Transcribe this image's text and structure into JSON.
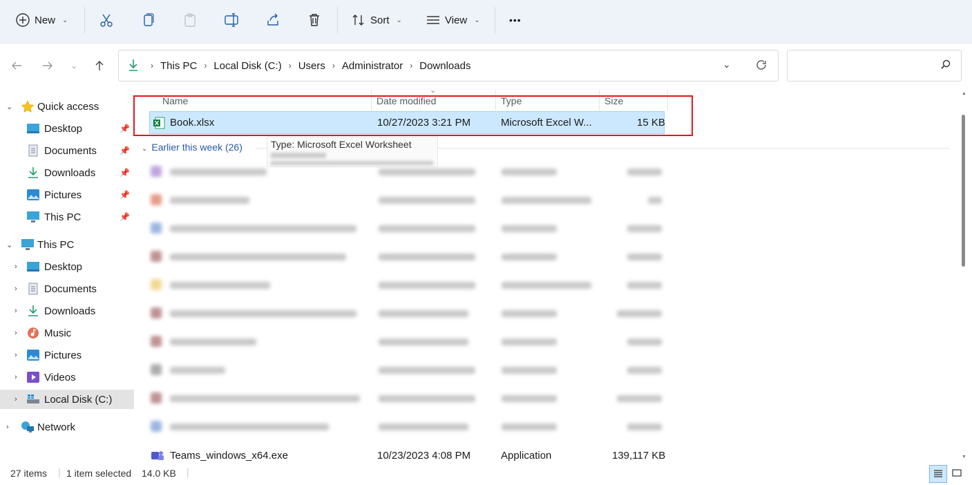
{
  "toolbar": {
    "new_label": "New",
    "sort_label": "Sort",
    "view_label": "View",
    "more_label": "•••"
  },
  "address": {
    "crumbs": [
      "This PC",
      "Local Disk (C:)",
      "Users",
      "Administrator",
      "Downloads"
    ]
  },
  "search": {
    "placeholder": ""
  },
  "sidebar": {
    "quick_access": "Quick access",
    "qa_items": [
      "Desktop",
      "Documents",
      "Downloads",
      "Pictures",
      "This PC"
    ],
    "this_pc": "This PC",
    "pc_items": [
      "Desktop",
      "Documents",
      "Downloads",
      "Music",
      "Pictures",
      "Videos",
      "Local Disk (C:)"
    ],
    "network": "Network"
  },
  "columns": {
    "name": "Name",
    "date": "Date modified",
    "type": "Type",
    "size": "Size"
  },
  "selected_file": {
    "name": "Book.xlsx",
    "date": "10/27/2023 3:21 PM",
    "type": "Microsoft Excel W...",
    "size": "15 KB"
  },
  "tooltip": {
    "type_line": "Type: Microsoft Excel Worksheet"
  },
  "group": {
    "label": "Earlier this week (26)"
  },
  "last_file": {
    "name": "Teams_windows_x64.exe",
    "date": "10/23/2023 4:08 PM",
    "type": "Application",
    "size": "139,117 KB"
  },
  "status": {
    "items": "27 items",
    "selected": "1 item selected",
    "size": "14.0 KB"
  },
  "colors": {
    "selection": "#cce8ff",
    "highlight_box": "#e8131b",
    "toolbar_bg": "#eef3f9"
  }
}
